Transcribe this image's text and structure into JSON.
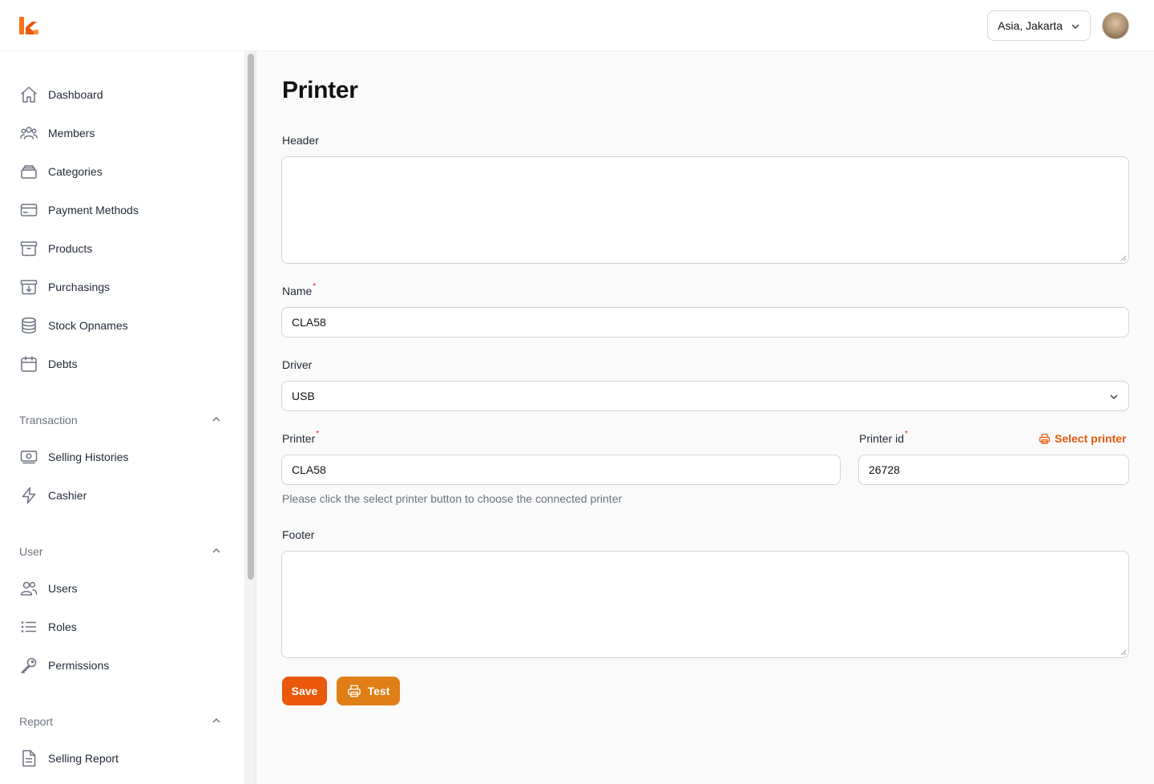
{
  "header": {
    "timezone": "Asia, Jakarta",
    "brand_color": "#ea580c"
  },
  "sidebar": {
    "main_items": [
      {
        "label": "Dashboard",
        "icon": "home-icon"
      },
      {
        "label": "Members",
        "icon": "user-group-icon"
      },
      {
        "label": "Categories",
        "icon": "stack-icon"
      },
      {
        "label": "Payment Methods",
        "icon": "credit-card-icon"
      },
      {
        "label": "Products",
        "icon": "archive-box-icon"
      },
      {
        "label": "Purchasings",
        "icon": "archive-box-arrow-down-icon"
      },
      {
        "label": "Stock Opnames",
        "icon": "database-icon"
      },
      {
        "label": "Debts",
        "icon": "calendar-icon"
      }
    ],
    "groups": [
      {
        "title": "Transaction",
        "items": [
          {
            "label": "Selling Histories",
            "icon": "banknotes-icon"
          },
          {
            "label": "Cashier",
            "icon": "bolt-icon"
          }
        ]
      },
      {
        "title": "User",
        "items": [
          {
            "label": "Users",
            "icon": "users-icon"
          },
          {
            "label": "Roles",
            "icon": "list-bullet-icon"
          },
          {
            "label": "Permissions",
            "icon": "key-icon"
          }
        ]
      },
      {
        "title": "Report",
        "items": [
          {
            "label": "Selling Report",
            "icon": "document-text-icon"
          }
        ]
      }
    ]
  },
  "form": {
    "title": "Printer",
    "header_label": "Header",
    "header_value": "",
    "name_label": "Name",
    "name_value": "CLA58",
    "driver_label": "Driver",
    "driver_value": "USB",
    "printer_label": "Printer",
    "printer_value": "CLA58",
    "printer_id_label": "Printer id",
    "printer_id_value": "26728",
    "select_printer_label": "Select printer",
    "printer_hint": "Please click the select printer button to choose the connected printer",
    "footer_label": "Footer",
    "footer_value": "",
    "required_marker": "*",
    "save_label": "Save",
    "test_label": "Test"
  }
}
